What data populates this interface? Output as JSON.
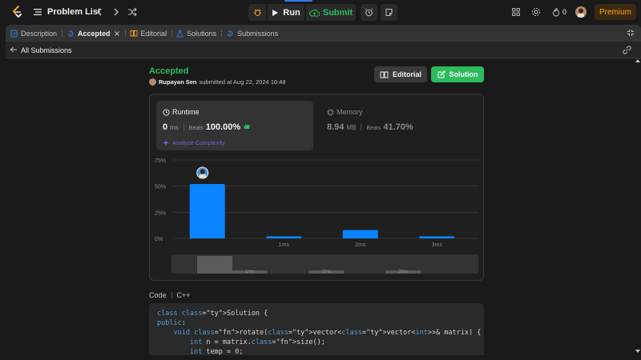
{
  "topbar": {
    "problem_list_label": "Problem List",
    "run_label": "Run",
    "submit_label": "Submit",
    "fire_count": "0",
    "premium_label": "Premium"
  },
  "tabs": [
    {
      "label": "Description",
      "icon": "description-icon"
    },
    {
      "label": "Accepted",
      "icon": "history-icon",
      "active": true
    },
    {
      "label": "Editorial",
      "icon": "book-icon"
    },
    {
      "label": "Solutions",
      "icon": "flask-icon"
    },
    {
      "label": "Submissions",
      "icon": "history-icon"
    }
  ],
  "subheader": {
    "back_label": "All Submissions"
  },
  "submission": {
    "status": "Accepted",
    "user": "Rupayan Sen",
    "submitted_text": "submitted at Aug 22, 2024 10:48",
    "editorial_button": "Editorial",
    "solution_button": "Solution"
  },
  "runtime": {
    "title": "Runtime",
    "value": "0",
    "unit": "ms",
    "beats_label": "Beats",
    "beats_value": "100.00%",
    "analyze_label": "Analyze Complexity"
  },
  "memory": {
    "title": "Memory",
    "value": "8.94",
    "unit": "MB",
    "beats_label": "Beats",
    "beats_value": "41.70%"
  },
  "chart_data": {
    "type": "bar",
    "categories": [
      "0ms",
      "1ms",
      "2ms",
      "3ms"
    ],
    "x_tick_labels": [
      "",
      "1ms",
      "2ms",
      "3ms"
    ],
    "values": [
      52,
      2,
      8,
      2
    ],
    "y_ticks": [
      "0%",
      "25%",
      "50%",
      "75%"
    ],
    "ylim": [
      0,
      75
    ],
    "highlight_index": 0,
    "bar_color": "#0a84ff",
    "grid": true,
    "minimap_tick_labels": [
      "1ms",
      "2ms",
      "3ms"
    ]
  },
  "code": {
    "label": "Code",
    "language": "C++",
    "lines": [
      "class Solution {",
      "public:",
      "    void rotate(vector<vector<int>>& matrix) {",
      "        int n = matrix.size();",
      "        int temp = 0;"
    ]
  },
  "colors": {
    "accent_green": "#2cbb5d",
    "premium_orange": "#ffa116",
    "bar_blue": "#0a84ff",
    "analyze_purple": "#7e5fd4"
  }
}
